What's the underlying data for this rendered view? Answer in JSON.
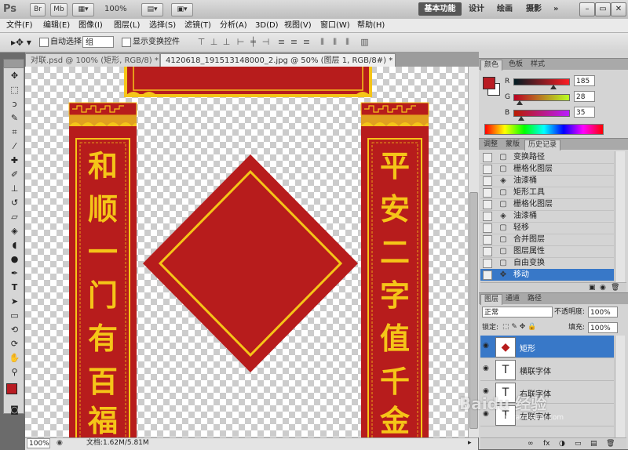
{
  "app": {
    "logo": "Ps",
    "buttons": [
      "Br",
      "Mb"
    ],
    "zoom_level": "100%",
    "workspaces": [
      "基本功能",
      "设计",
      "绘画",
      "摄影"
    ],
    "more": "»",
    "window_controls": [
      "–",
      "▭",
      "✕"
    ]
  },
  "menu": [
    "文件(F)",
    "编辑(E)",
    "图像(I)",
    "图层(L)",
    "选择(S)",
    "滤镜(T)",
    "分析(A)",
    "3D(D)",
    "视图(V)",
    "窗口(W)",
    "帮助(H)"
  ],
  "options": {
    "auto_select_label": "自动选择:",
    "auto_select_value": "组",
    "show_transform_label": "显示变换控件"
  },
  "tabs": [
    {
      "label": "对联.psd @ 100% (矩形, RGB/8) *",
      "close": "×"
    },
    {
      "label": "4120618_191513148000_2.jpg @ 50% (图层 1, RGB/8#) *",
      "close": "×"
    }
  ],
  "artwork": {
    "left_couplet": [
      "和",
      "顺",
      "一",
      "门",
      "有",
      "百",
      "福"
    ],
    "right_couplet": [
      "平",
      "安",
      "二",
      "字",
      "值",
      "千",
      "金"
    ],
    "colors": {
      "red": "#b71c1c",
      "gold": "#f5c518",
      "dark_red": "#8e1010"
    }
  },
  "status": {
    "zoom": "100%",
    "doc_info": "文档:1.62M/5.81M"
  },
  "color_panel": {
    "tabs": [
      "颜色",
      "色板",
      "样式"
    ],
    "r_label": "R",
    "g_label": "G",
    "b_label": "B",
    "r": "185",
    "g": "28",
    "b": "35",
    "r_fraction": 0.725,
    "g_fraction": 0.11,
    "b_fraction": 0.137,
    "foreground": "#b91c23"
  },
  "history_panel": {
    "tabs": [
      "调整",
      "蒙版",
      "历史记录"
    ],
    "items": [
      {
        "icon": "▢",
        "label": "变换路径"
      },
      {
        "icon": "▢",
        "label": "栅格化图层"
      },
      {
        "icon": "◈",
        "label": "油漆桶"
      },
      {
        "icon": "▢",
        "label": "矩形工具"
      },
      {
        "icon": "▢",
        "label": "栅格化图层"
      },
      {
        "icon": "◈",
        "label": "油漆桶"
      },
      {
        "icon": "▢",
        "label": "轻移"
      },
      {
        "icon": "▢",
        "label": "合并图层"
      },
      {
        "icon": "▢",
        "label": "图层属性"
      },
      {
        "icon": "▢",
        "label": "自由变换"
      },
      {
        "icon": "✥",
        "label": "移动"
      }
    ]
  },
  "layers_panel": {
    "tabs": [
      "图层",
      "通道",
      "路径"
    ],
    "blend_mode": "正常",
    "opacity_label": "不透明度:",
    "opacity": "100%",
    "lock_label": "锁定:",
    "fill_label": "填充:",
    "fill": "100%",
    "layers": [
      {
        "thumb": "◆",
        "name": "矩形"
      },
      {
        "thumb": "T",
        "name": "横联字体"
      },
      {
        "thumb": "T",
        "name": "右联字体"
      },
      {
        "thumb": "T",
        "name": "左联字体"
      }
    ],
    "footer_icons": [
      "∞",
      "fx",
      "◑",
      "▭",
      "▤",
      "🗑"
    ]
  },
  "watermark": "Baidu 经验",
  "watermark_sub": "jingyan.baidu.com"
}
